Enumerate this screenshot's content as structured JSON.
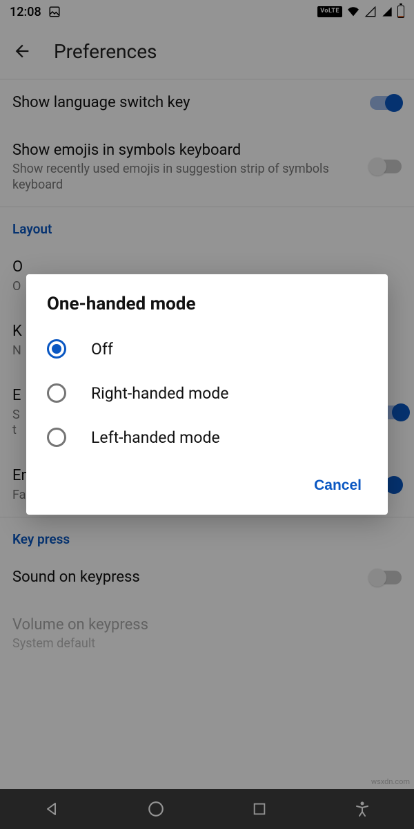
{
  "status": {
    "time": "12:08",
    "volte": "VoLTE"
  },
  "header": {
    "title": "Preferences"
  },
  "settings": {
    "show_lang_key": {
      "title": "Show language switch key",
      "on": true
    },
    "show_emojis": {
      "title": "Show emojis in symbols keyboard",
      "sub": "Show recently used emojis in suggestion strip of symbols keyboard",
      "on": false
    },
    "section_layout": "Layout",
    "one_handed": {
      "title_partial": "O",
      "sub_partial": "O"
    },
    "keyboard_height": {
      "title_partial": "K",
      "sub_partial": "N"
    },
    "row3": {
      "title_partial": "E",
      "sub_partial_a": "S",
      "sub_partial_b": "t"
    },
    "emoji_bar": {
      "title": "Emoji fast-access bar",
      "sub": "Fast access bar on the typing keyboard for popular emojis.",
      "on": true
    },
    "section_keypress": "Key press",
    "sound": {
      "title": "Sound on keypress",
      "on": false
    },
    "volume": {
      "title": "Volume on keypress",
      "sub": "System default"
    }
  },
  "dialog": {
    "title": "One-handed mode",
    "options": [
      {
        "label": "Off",
        "selected": true
      },
      {
        "label": "Right-handed mode",
        "selected": false
      },
      {
        "label": "Left-handed mode",
        "selected": false
      }
    ],
    "cancel": "Cancel"
  },
  "watermark": "wsxdn.com"
}
